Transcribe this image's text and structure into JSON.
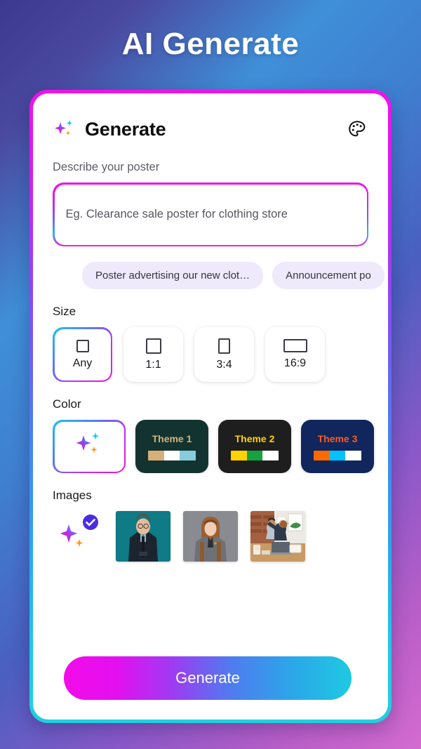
{
  "page": {
    "title": "AI Generate",
    "background_top": "#3b3a8f",
    "background_bottom": "#d46bd0"
  },
  "card": {
    "border_gradient_start": "#f012e8",
    "border_gradient_end": "#1ed0e0",
    "header": {
      "title": "Generate",
      "spark_icon": "sparkles-icon",
      "palette_icon": "palette-icon"
    }
  },
  "prompt": {
    "label": "Describe your poster",
    "placeholder": "Eg. Clearance sale poster for clothing store",
    "value": ""
  },
  "suggestions": {
    "chips": [
      {
        "label": "Poster advertising our new clot…"
      },
      {
        "label": "Announcement po"
      }
    ]
  },
  "size": {
    "label": "Size",
    "options": [
      {
        "label": "Any",
        "shape": "shape-any",
        "selected": true
      },
      {
        "label": "1:1",
        "shape": "shape-11",
        "selected": false
      },
      {
        "label": "3:4",
        "shape": "shape-34",
        "selected": false
      },
      {
        "label": "16:9",
        "shape": "shape-169",
        "selected": false
      }
    ]
  },
  "color": {
    "label": "Color",
    "options": [
      {
        "name": "AI",
        "type": "ai",
        "selected": true,
        "icon": "sparkles-icon"
      },
      {
        "name": "Theme 1",
        "type": "theme",
        "selected": false,
        "bg": "#133330",
        "text_color": "#d3b27a",
        "swatches": [
          "#d6b078",
          "#ffffff",
          "#88ccdc"
        ]
      },
      {
        "name": "Theme 2",
        "type": "theme",
        "selected": false,
        "bg": "#1e1e1e",
        "text_color": "#ffd200",
        "swatches": [
          "#ffd200",
          "#14a33f",
          "#ffffff"
        ]
      },
      {
        "name": "Theme 3",
        "type": "theme",
        "selected": false,
        "bg": "#10265c",
        "text_color": "#ff5a1f",
        "swatches": [
          "#ff6a00",
          "#00c2ff",
          "#ffffff"
        ]
      }
    ]
  },
  "images": {
    "label": "Images",
    "options": [
      {
        "name": "AI image",
        "type": "ai",
        "selected": true,
        "icon": "sparkles-icon",
        "badge": "check-badge-icon"
      },
      {
        "name": "Businessman portrait",
        "type": "photo",
        "selected": false,
        "bg": "#0e7b86"
      },
      {
        "name": "Businesswoman portrait",
        "type": "photo",
        "selected": false,
        "bg": "#8a8a91"
      },
      {
        "name": "Team high five",
        "type": "photo",
        "selected": false,
        "bg": "#b07a5c"
      }
    ]
  },
  "actions": {
    "generate_label": "Generate"
  }
}
